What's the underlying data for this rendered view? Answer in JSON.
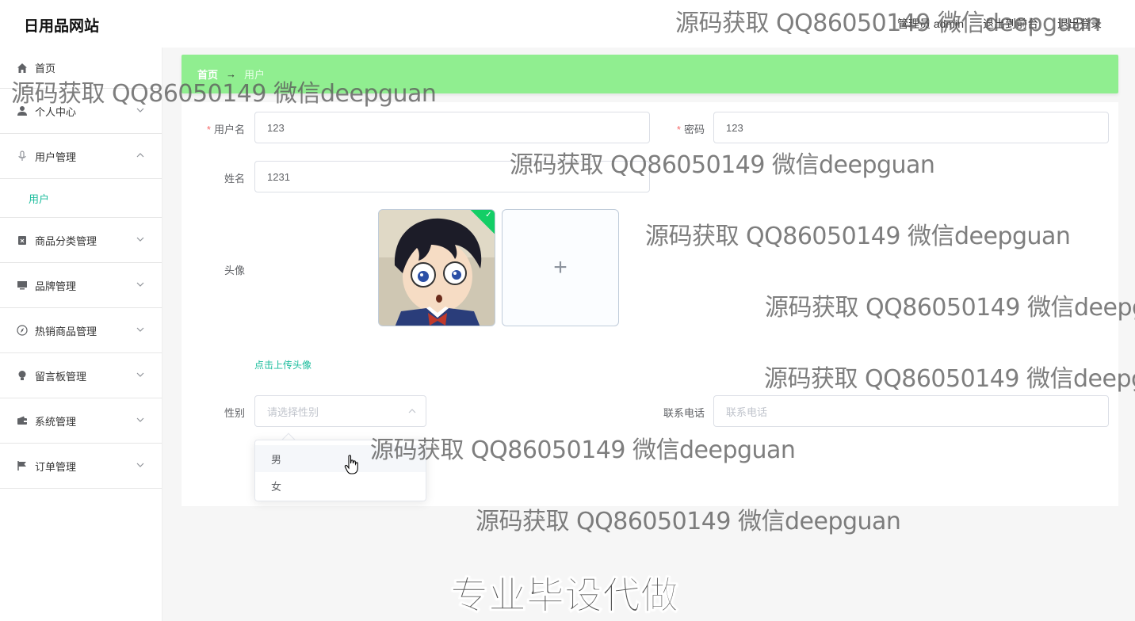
{
  "site_title": "日用品网站",
  "header": {
    "user_label": "管理员 admin",
    "back_to_front": "退出到前台",
    "logout": "退出登录"
  },
  "sidebar": {
    "items": [
      {
        "label": "首页",
        "icon": "home-icon"
      },
      {
        "label": "个人中心",
        "icon": "user-icon"
      },
      {
        "label": "用户管理",
        "icon": "microphone-icon",
        "expanded": true
      },
      {
        "label": "商品分类管理",
        "icon": "clipboard-icon"
      },
      {
        "label": "品牌管理",
        "icon": "monitor-icon"
      },
      {
        "label": "热销商品管理",
        "icon": "compass-icon"
      },
      {
        "label": "留言板管理",
        "icon": "lightbulb-icon"
      },
      {
        "label": "系统管理",
        "icon": "wallet-icon"
      },
      {
        "label": "订单管理",
        "icon": "flag-icon"
      }
    ],
    "submenu": {
      "label": "用户"
    }
  },
  "breadcrumb": {
    "home": "首页",
    "separator": "→",
    "current": "用户"
  },
  "form": {
    "username_label": "用户名",
    "username_value": "123",
    "password_label": "密码",
    "password_value": "123",
    "name_label": "姓名",
    "name_value": "1231",
    "avatar_label": "头像",
    "upload_plus": "+",
    "upload_tip": "点击上传头像",
    "gender_label": "性别",
    "gender_placeholder": "请选择性别",
    "phone_label": "联系电话",
    "phone_placeholder": "联系电话",
    "gender_options": [
      "男",
      "女"
    ]
  },
  "watermarks": {
    "text": "源码获取 QQ86050149 微信deepguan",
    "banner": "专业毕设代做"
  },
  "colors": {
    "accent": "#1abc9c",
    "breadcrumb_bg": "#90ee90",
    "required": "#f56c6c",
    "success_badge": "#13ce66"
  }
}
